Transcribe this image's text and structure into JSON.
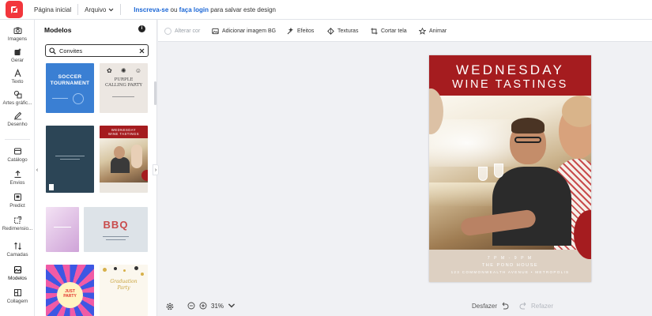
{
  "topbar": {
    "home": "Página inicial",
    "file_menu": "Arquivo",
    "signup_link": "Inscreva-se",
    "signup_or": "ou",
    "login_link": "faça login",
    "signup_suffix": "para salvar este design"
  },
  "rail": {
    "items": [
      {
        "label": "Imagens",
        "icon": "camera-icon"
      },
      {
        "label": "Gerar",
        "icon": "magic-icon"
      },
      {
        "label": "Texto",
        "icon": "text-icon"
      },
      {
        "label": "Artes gráfic...",
        "icon": "shapes-icon"
      },
      {
        "label": "Desenho",
        "icon": "pencil-icon"
      },
      {
        "label": "Catálogo",
        "icon": "catalog-icon"
      },
      {
        "label": "Envios",
        "icon": "upload-icon"
      },
      {
        "label": "Predict",
        "icon": "predict-icon"
      },
      {
        "label": "Redimensio...",
        "icon": "resize-icon"
      },
      {
        "label": "Camadas",
        "icon": "layers-icon"
      },
      {
        "label": "Modelos",
        "icon": "templates-icon"
      },
      {
        "label": "Collagem",
        "icon": "collage-icon"
      }
    ]
  },
  "panel": {
    "title": "Modelos",
    "info": "i",
    "search_value": "Convites",
    "templates": {
      "soccer": "SOCCER TOURNAMENT",
      "party_line1": "PURPLE",
      "party_line2": "CALLING PARTY",
      "wine_line1": "WEDNESDAY",
      "wine_line2": "WINE TASTINGS",
      "bbq": "BBQ",
      "swirl_line1": "JUST",
      "swirl_line2": "PARTY",
      "grad_line1": "Graduation",
      "grad_line2": "Party"
    }
  },
  "toolbar": {
    "change_color": "Alterar cor",
    "add_bg": "Adicionar imagem BG",
    "effects": "Efeitos",
    "textures": "Texturas",
    "crop": "Cortar tela",
    "animate": "Animar"
  },
  "canvas": {
    "title_line1": "WEDNESDAY",
    "title_line2": "WINE TASTINGS",
    "footer_time": "7 P M   -   9 P M",
    "footer_venue": "THE POND HOUSE",
    "footer_address": "123 COMMONWEALTH AVENUE • METROPOLIS"
  },
  "bottom": {
    "zoom_value": "31%",
    "undo": "Desfazer",
    "redo": "Refazer"
  },
  "colors": {
    "brand": "#f2363c",
    "link": "#1a66d6",
    "wine_red": "#a51c1f",
    "beige": "#ddd0c2"
  }
}
